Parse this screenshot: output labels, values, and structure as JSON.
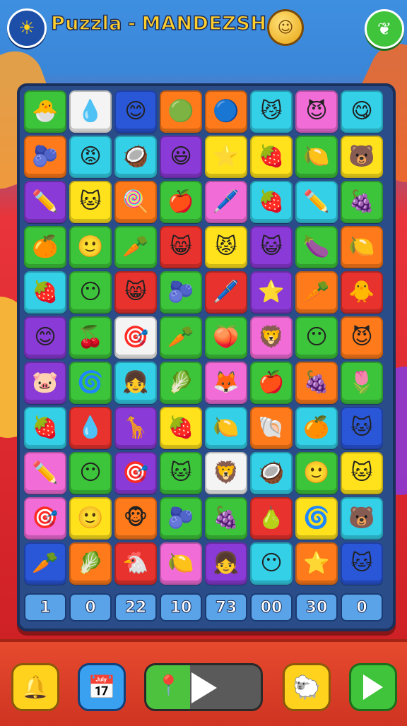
{
  "header": {
    "title_left": "Puzzla",
    "title_dash": "-",
    "title_right": "MANDEZSH",
    "logo_icon": "sun-badge-icon",
    "coin_icon": "coin-face-icon",
    "leaf_icon": "leaf-icon"
  },
  "colors": {
    "green": "#3cc43a",
    "white": "#f4f4f4",
    "blue": "#2a56d8",
    "orange": "#ff7a1a",
    "red": "#e8322e",
    "cyan": "#33d0e8",
    "pink": "#f26cd8",
    "yellow": "#ffe21c",
    "purple": "#8a3ad6"
  },
  "board": {
    "rows": [
      [
        {
          "c": "green",
          "g": "🐣"
        },
        {
          "c": "white",
          "g": "💧"
        },
        {
          "c": "blue",
          "g": "😊"
        },
        {
          "c": "orange",
          "g": "🟢"
        },
        {
          "c": "orange",
          "g": "🔵"
        },
        {
          "c": "cyan",
          "g": "😼"
        },
        {
          "c": "pink",
          "g": "😈"
        },
        {
          "c": "cyan",
          "g": "😋"
        }
      ],
      [
        {
          "c": "orange",
          "g": "🫐"
        },
        {
          "c": "cyan",
          "g": "😡"
        },
        {
          "c": "cyan",
          "g": "🥥"
        },
        {
          "c": "purple",
          "g": "😃"
        },
        {
          "c": "yellow",
          "g": "⭐"
        },
        {
          "c": "yellow",
          "g": "🍓"
        },
        {
          "c": "green",
          "g": "🍋"
        },
        {
          "c": "yellow",
          "g": "🐻"
        }
      ],
      [
        {
          "c": "purple",
          "g": "✏️"
        },
        {
          "c": "yellow",
          "g": "🐱"
        },
        {
          "c": "orange",
          "g": "🍭"
        },
        {
          "c": "green",
          "g": "🍎"
        },
        {
          "c": "pink",
          "g": "🖊️"
        },
        {
          "c": "cyan",
          "g": "🍓"
        },
        {
          "c": "cyan",
          "g": "✏️"
        },
        {
          "c": "green",
          "g": "🍇"
        }
      ],
      [
        {
          "c": "green",
          "g": "🍊"
        },
        {
          "c": "green",
          "g": "🙂"
        },
        {
          "c": "green",
          "g": "🥕"
        },
        {
          "c": "red",
          "g": "😸"
        },
        {
          "c": "yellow",
          "g": "😾"
        },
        {
          "c": "purple",
          "g": "😺"
        },
        {
          "c": "green",
          "g": "🍆"
        },
        {
          "c": "orange",
          "g": "🍋"
        }
      ],
      [
        {
          "c": "cyan",
          "g": "🍓"
        },
        {
          "c": "green",
          "g": "😶"
        },
        {
          "c": "red",
          "g": "😸"
        },
        {
          "c": "green",
          "g": "🫐"
        },
        {
          "c": "red",
          "g": "🖊️"
        },
        {
          "c": "purple",
          "g": "⭐"
        },
        {
          "c": "orange",
          "g": "🥕"
        },
        {
          "c": "red",
          "g": "🐥"
        }
      ],
      [
        {
          "c": "purple",
          "g": "😊"
        },
        {
          "c": "green",
          "g": "🍒"
        },
        {
          "c": "white",
          "g": "🎯"
        },
        {
          "c": "green",
          "g": "🥕"
        },
        {
          "c": "green",
          "g": "🍑"
        },
        {
          "c": "pink",
          "g": "🦁"
        },
        {
          "c": "green",
          "g": "😶"
        },
        {
          "c": "orange",
          "g": "😈"
        }
      ],
      [
        {
          "c": "purple",
          "g": "🐷"
        },
        {
          "c": "green",
          "g": "🌀"
        },
        {
          "c": "cyan",
          "g": "👧"
        },
        {
          "c": "green",
          "g": "🥬"
        },
        {
          "c": "pink",
          "g": "🦊"
        },
        {
          "c": "green",
          "g": "🍎"
        },
        {
          "c": "orange",
          "g": "🍇"
        },
        {
          "c": "green",
          "g": "🌷"
        }
      ],
      [
        {
          "c": "cyan",
          "g": "🍓"
        },
        {
          "c": "red",
          "g": "💧"
        },
        {
          "c": "purple",
          "g": "🦒"
        },
        {
          "c": "yellow",
          "g": "🍓"
        },
        {
          "c": "cyan",
          "g": "🍋"
        },
        {
          "c": "orange",
          "g": "🐚"
        },
        {
          "c": "cyan",
          "g": "🍊"
        },
        {
          "c": "blue",
          "g": "🐱"
        }
      ],
      [
        {
          "c": "pink",
          "g": "✏️"
        },
        {
          "c": "green",
          "g": "😶"
        },
        {
          "c": "purple",
          "g": "🎯"
        },
        {
          "c": "green",
          "g": "🐱"
        },
        {
          "c": "white",
          "g": "🦁"
        },
        {
          "c": "cyan",
          "g": "🥥"
        },
        {
          "c": "green",
          "g": "🙂"
        },
        {
          "c": "yellow",
          "g": "🐱"
        }
      ],
      [
        {
          "c": "pink",
          "g": "🎯"
        },
        {
          "c": "yellow",
          "g": "🙂"
        },
        {
          "c": "orange",
          "g": "🐵"
        },
        {
          "c": "green",
          "g": "🫐"
        },
        {
          "c": "green",
          "g": "🍇"
        },
        {
          "c": "red",
          "g": "🍐"
        },
        {
          "c": "yellow",
          "g": "🌀"
        },
        {
          "c": "cyan",
          "g": "🐻"
        }
      ],
      [
        {
          "c": "blue",
          "g": "🥕"
        },
        {
          "c": "orange",
          "g": "🥬"
        },
        {
          "c": "red",
          "g": "🐔"
        },
        {
          "c": "pink",
          "g": "🍋"
        },
        {
          "c": "purple",
          "g": "👧"
        },
        {
          "c": "cyan",
          "g": "😶"
        },
        {
          "c": "orange",
          "g": "⭐"
        },
        {
          "c": "blue",
          "g": "🐱"
        }
      ]
    ],
    "scores": [
      "1",
      "0",
      "22",
      "10",
      "73",
      "00",
      "30",
      "0"
    ]
  },
  "footer": {
    "bell_icon": "bell-icon",
    "calendar_icon": "calendar-icon",
    "play_bar_fill": 0.38,
    "pin_icon": "map-pin-icon",
    "play_icon": "play-icon",
    "character_icon": "character-face-icon",
    "next_icon": "next-arrow-icon"
  }
}
